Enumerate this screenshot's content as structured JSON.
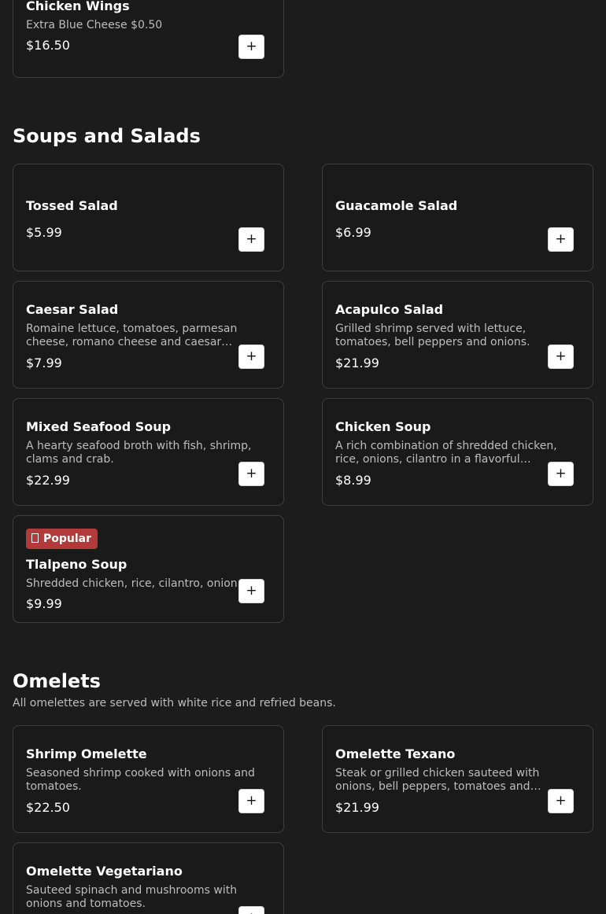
{
  "sections": {
    "appetizers": {
      "items": [
        {
          "name": "Chicken Wings",
          "description": "Extra Blue Cheese $0.50",
          "price": "$16.50"
        }
      ]
    },
    "soups_salads": {
      "title": "Soups and Salads",
      "items": [
        {
          "name": "Tossed Salad",
          "description": "",
          "price": "$5.99"
        },
        {
          "name": "Guacamole Salad",
          "description": "",
          "price": "$6.99"
        },
        {
          "name": "Caesar Salad",
          "description": "Romaine lettuce, tomatoes, parmesan cheese, romano cheese and caesar…",
          "price": "$7.99"
        },
        {
          "name": "Acapulco Salad",
          "description": "Grilled shrimp served with lettuce, tomatoes, bell peppers and onions.",
          "price": "$21.99"
        },
        {
          "name": "Mixed Seafood Soup",
          "description": "A hearty seafood broth with fish, shrimp, clams and crab.",
          "price": "$22.99"
        },
        {
          "name": "Chicken Soup",
          "description": "A rich combination of shredded chicken, rice, onions, cilantro in a flavorful chicken…",
          "price": "$8.99"
        },
        {
          "name": "Tlalpeno Soup",
          "description": "Shredded chicken, rice, cilantro, onion",
          "price": "$9.99",
          "badge": "Popular"
        }
      ]
    },
    "omelets": {
      "title": "Omelets",
      "note": "All omelettes are served with white rice and refried beans.",
      "items": [
        {
          "name": "Shrimp Omelette",
          "description": "Seasoned shrimp cooked with onions and tomatoes.",
          "price": "$22.50"
        },
        {
          "name": "Omelette Texano",
          "description": "Steak or grilled chicken sauteed with onions, bell peppers, tomatoes and cheese.",
          "price": "$21.99"
        },
        {
          "name": "Omelette Vegetariano",
          "description": "Sauteed spinach and mushrooms with onions and tomatoes.",
          "price": ""
        }
      ]
    }
  },
  "add_button": {
    "label": "+"
  },
  "icons": {
    "badge_icon": "flame-icon"
  },
  "colors": {
    "background": "#1c1c1c",
    "card_border": "#3e3e3e",
    "badge": "#b23a3a",
    "muted_text": "#bdbdbd"
  }
}
